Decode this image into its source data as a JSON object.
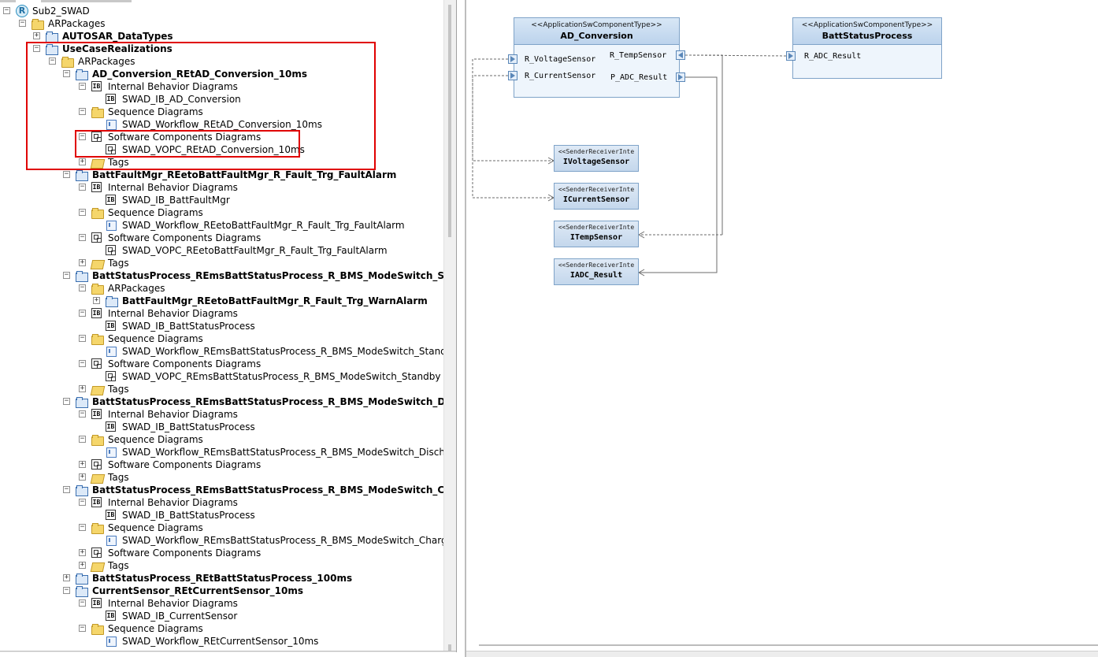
{
  "tree": {
    "root": "Sub2_SWAD",
    "items": [
      {
        "label": "ARPackages",
        "bold": false
      },
      {
        "label": "AUTOSAR_DataTypes",
        "bold": true
      },
      {
        "label": "UseCaseRealizations",
        "bold": true
      },
      {
        "label": "ARPackages",
        "bold": false
      },
      {
        "label": "AD_Conversion_REtAD_Conversion_10ms",
        "bold": true
      },
      {
        "label": "Internal Behavior Diagrams",
        "bold": false
      },
      {
        "label": "SWAD_IB_AD_Conversion",
        "bold": false
      },
      {
        "label": "Sequence Diagrams",
        "bold": false
      },
      {
        "label": "SWAD_Workflow_REtAD_Conversion_10ms",
        "bold": false
      },
      {
        "label": "Software Components Diagrams",
        "bold": false
      },
      {
        "label": "SWAD_VOPC_REtAD_Conversion_10ms",
        "bold": false
      },
      {
        "label": "Tags",
        "bold": false
      },
      {
        "label": "BattFaultMgr_REetoBattFaultMgr_R_Fault_Trg_FaultAlarm",
        "bold": true
      },
      {
        "label": "Internal Behavior Diagrams",
        "bold": false
      },
      {
        "label": "SWAD_IB_BattFaultMgr",
        "bold": false
      },
      {
        "label": "Sequence Diagrams",
        "bold": false
      },
      {
        "label": "SWAD_Workflow_REetoBattFaultMgr_R_Fault_Trg_FaultAlarm",
        "bold": false
      },
      {
        "label": "Software Components Diagrams",
        "bold": false
      },
      {
        "label": "SWAD_VOPC_REetoBattFaultMgr_R_Fault_Trg_FaultAlarm",
        "bold": false
      },
      {
        "label": "Tags",
        "bold": false
      },
      {
        "label": "BattStatusProcess_REmsBattStatusProcess_R_BMS_ModeSwitch_Standby",
        "bold": true
      },
      {
        "label": "ARPackages",
        "bold": false
      },
      {
        "label": "BattFaultMgr_REetoBattFaultMgr_R_Fault_Trg_WarnAlarm",
        "bold": true
      },
      {
        "label": "Internal Behavior Diagrams",
        "bold": false
      },
      {
        "label": "SWAD_IB_BattStatusProcess",
        "bold": false
      },
      {
        "label": "Sequence Diagrams",
        "bold": false
      },
      {
        "label": "SWAD_Workflow_REmsBattStatusProcess_R_BMS_ModeSwitch_Standby",
        "bold": false
      },
      {
        "label": "Software Components Diagrams",
        "bold": false
      },
      {
        "label": "SWAD_VOPC_REmsBattStatusProcess_R_BMS_ModeSwitch_Standby",
        "bold": false
      },
      {
        "label": "Tags",
        "bold": false
      },
      {
        "label": "BattStatusProcess_REmsBattStatusProcess_R_BMS_ModeSwitch_Discharge",
        "bold": true
      },
      {
        "label": "Internal Behavior Diagrams",
        "bold": false
      },
      {
        "label": "SWAD_IB_BattStatusProcess",
        "bold": false
      },
      {
        "label": "Sequence Diagrams",
        "bold": false
      },
      {
        "label": "SWAD_Workflow_REmsBattStatusProcess_R_BMS_ModeSwitch_Discharge",
        "bold": false
      },
      {
        "label": "Software Components Diagrams",
        "bold": false
      },
      {
        "label": "Tags",
        "bold": false
      },
      {
        "label": "BattStatusProcess_REmsBattStatusProcess_R_BMS_ModeSwitch_Charge",
        "bold": true
      },
      {
        "label": "Internal Behavior Diagrams",
        "bold": false
      },
      {
        "label": "SWAD_IB_BattStatusProcess",
        "bold": false
      },
      {
        "label": "Sequence Diagrams",
        "bold": false
      },
      {
        "label": "SWAD_Workflow_REmsBattStatusProcess_R_BMS_ModeSwitch_Charge",
        "bold": false
      },
      {
        "label": "Software Components Diagrams",
        "bold": false
      },
      {
        "label": "Tags",
        "bold": false
      },
      {
        "label": "BattStatusProcess_REtBattStatusProcess_100ms",
        "bold": true
      },
      {
        "label": "CurrentSensor_REtCurrentSensor_10ms",
        "bold": true
      },
      {
        "label": "Internal Behavior Diagrams",
        "bold": false
      },
      {
        "label": "SWAD_IB_CurrentSensor",
        "bold": false
      },
      {
        "label": "Sequence Diagrams",
        "bold": false
      },
      {
        "label": "SWAD_Workflow_REtCurrentSensor_10ms",
        "bold": false
      }
    ]
  },
  "diagram": {
    "components": [
      {
        "stereotype": "<<ApplicationSwComponentType>>",
        "name": "AD_Conversion",
        "ports": [
          "R_VoltageSensor",
          "R_CurrentSensor",
          "R_TempSensor",
          "P_ADC_Result"
        ]
      },
      {
        "stereotype": "<<ApplicationSwComponentType>>",
        "name": "BattStatusProcess",
        "ports": [
          "R_ADC_Result"
        ]
      }
    ],
    "interfaces": [
      {
        "stereotype": "<<SenderReceiverInte",
        "name": "IVoltageSensor"
      },
      {
        "stereotype": "<<SenderReceiverInte",
        "name": "ICurrentSensor"
      },
      {
        "stereotype": "<<SenderReceiverInte",
        "name": "ITempSensor"
      },
      {
        "stereotype": "<<SenderReceiverInte",
        "name": "IADC_Result"
      }
    ]
  },
  "colors": {
    "highlight": "#e00000",
    "component_header": "#c8dbef",
    "port": "#5a87b8"
  }
}
